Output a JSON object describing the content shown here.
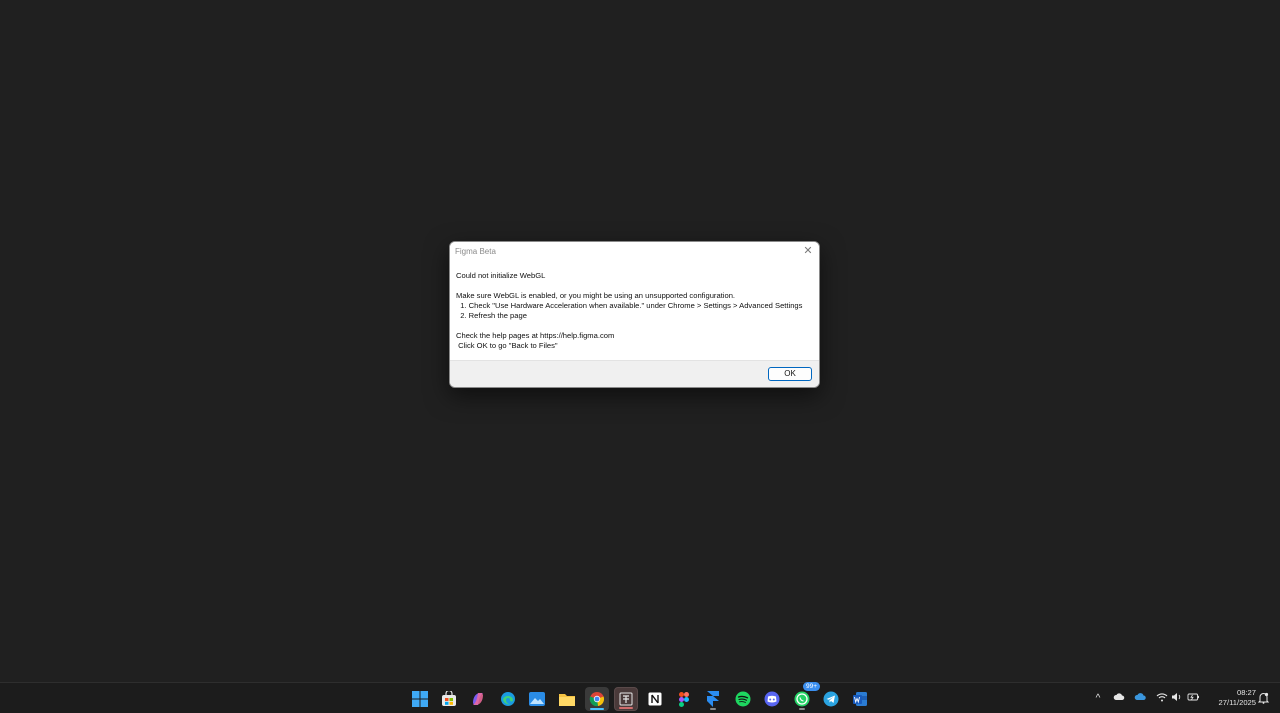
{
  "dialog": {
    "title": "Figma Beta",
    "close_glyph": "✕",
    "lines": [
      "Could not initialize WebGL",
      "",
      "Make sure WebGL is enabled, or you might be using an unsupported configuration.",
      "  1. Check \"Use Hardware Acceleration when available.\" under Chrome > Settings > Advanced Settings",
      "  2. Refresh the page",
      "",
      "Check the help pages at https://help.figma.com",
      " Click OK to go \"Back to Files\""
    ],
    "ok_label": "OK"
  },
  "taskbar": {
    "apps": [
      {
        "name": "windows-start-icon"
      },
      {
        "name": "microsoft-store-icon"
      },
      {
        "name": "copilot-icon"
      },
      {
        "name": "edge-icon"
      },
      {
        "name": "photos-icon"
      },
      {
        "name": "file-explorer-icon"
      },
      {
        "name": "chrome-icon"
      },
      {
        "name": "figma-beta-icon"
      },
      {
        "name": "notion-icon"
      },
      {
        "name": "figma-icon"
      },
      {
        "name": "framer-icon"
      },
      {
        "name": "spotify-icon"
      },
      {
        "name": "discord-icon"
      },
      {
        "name": "whatsapp-icon",
        "badge": "99+"
      },
      {
        "name": "telegram-icon"
      },
      {
        "name": "word-icon"
      }
    ],
    "tray": {
      "chevron": "^",
      "time": "08:27",
      "date": "27/11/2025"
    }
  },
  "colors": {
    "desktop": "#202020",
    "taskbar": "#1c1c1c",
    "accent": "#0067c0"
  }
}
